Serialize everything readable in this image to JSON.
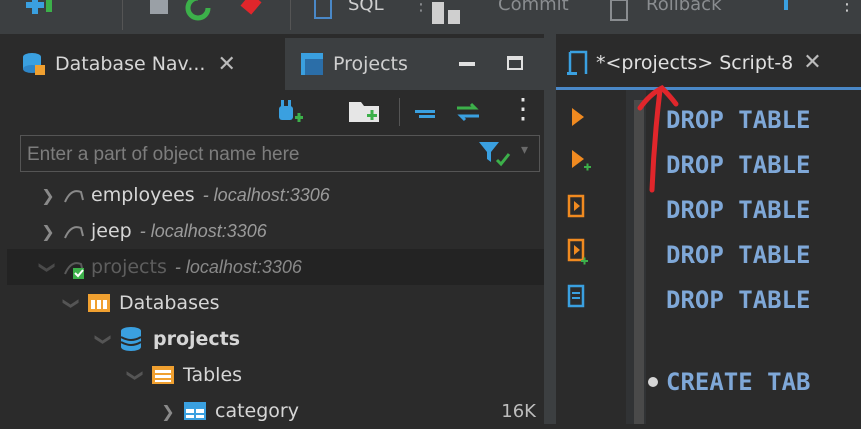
{
  "toolbar": {
    "sql_label": "SQL",
    "commit_label": "Commit",
    "rollback_label": "Rollback"
  },
  "left_tabs": {
    "db_nav": "Database Nav...",
    "projects": "Projects"
  },
  "filter": {
    "placeholder": "Enter a part of object name here"
  },
  "tree": {
    "employees": {
      "name": "employees",
      "host": "- localhost:3306"
    },
    "jeep": {
      "name": "jeep",
      "host": "- localhost:3306"
    },
    "projects": {
      "name": "projects",
      "host": "- localhost:3306"
    },
    "databases": "Databases",
    "db_projects": "projects",
    "tables": "Tables",
    "category": {
      "name": "category",
      "size": "16K"
    }
  },
  "editor": {
    "tab_title": "*<projects> Script-8",
    "lines": [
      "DROP TABLE",
      "DROP TABLE",
      "DROP TABLE",
      "DROP TABLE",
      "DROP TABLE",
      "CREATE TAB"
    ]
  },
  "colors": {
    "accent": "#4a88c7",
    "annotation": "#e0262b",
    "keyword": "#7fa8d8",
    "folder": "#f0a030"
  }
}
